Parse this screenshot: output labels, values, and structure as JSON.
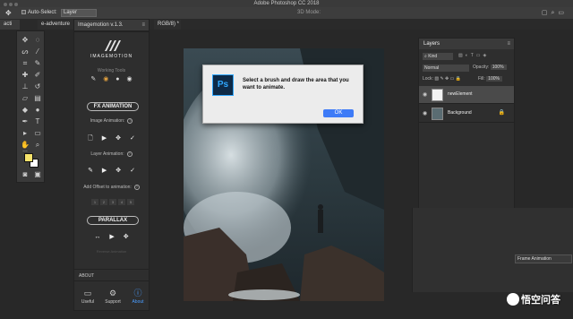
{
  "window": {
    "title": "Adobe Photoshop CC 2018"
  },
  "options_bar": {
    "auto_select_label": "Auto-Select:",
    "auto_select_value": "Layer",
    "mode_3d_label": "3D Mode:"
  },
  "tabs": [
    {
      "label": "acti"
    },
    {
      "label": "e-adventure"
    },
    {
      "label": "RGB/8) *"
    }
  ],
  "imotion": {
    "panel_title": "Imagemotion v.1.3.",
    "brand": "IMAGEMOTION",
    "working_tools_label": "Working Tools",
    "fx_animation": "FX ANIMATION",
    "image_animation_label": "Image Animation:",
    "layer_animation_label": "Layer Animation:",
    "offset_label": "Add Offset to animation:",
    "offsets": [
      "1",
      "2",
      "3",
      "4",
      "5"
    ],
    "parallax": "PARALLAX",
    "hint": "Reverse Animation",
    "about": "ABOUT",
    "bottom_tabs": [
      {
        "label": "Useful",
        "icon": "monitor-icon"
      },
      {
        "label": "Support",
        "icon": "gear-icon"
      },
      {
        "label": "About",
        "icon": "help-icon"
      }
    ]
  },
  "dialog": {
    "app_icon": "Ps",
    "message": "Select a brush and draw the area that you want to animate.",
    "ok_label": "OK"
  },
  "layers": {
    "title": "Layers",
    "filter": "Kind",
    "blend_mode": "Normal",
    "opacity_label": "Opacity:",
    "opacity_value": "100%",
    "lock_label": "Lock:",
    "fill_label": "Fill:",
    "fill_value": "100%",
    "items": [
      {
        "name": "newElement",
        "selected": true
      },
      {
        "name": "Background",
        "selected": false,
        "locked": true
      }
    ]
  },
  "timeline": {
    "create_frame_label": "Frame Animation"
  },
  "watermark": {
    "text": "悟空问答"
  },
  "colors": {
    "foreground": "#f6e36b",
    "background": "#ffffff",
    "ok_button": "#3e7bf7",
    "ps_blue": "#31a8ff"
  }
}
